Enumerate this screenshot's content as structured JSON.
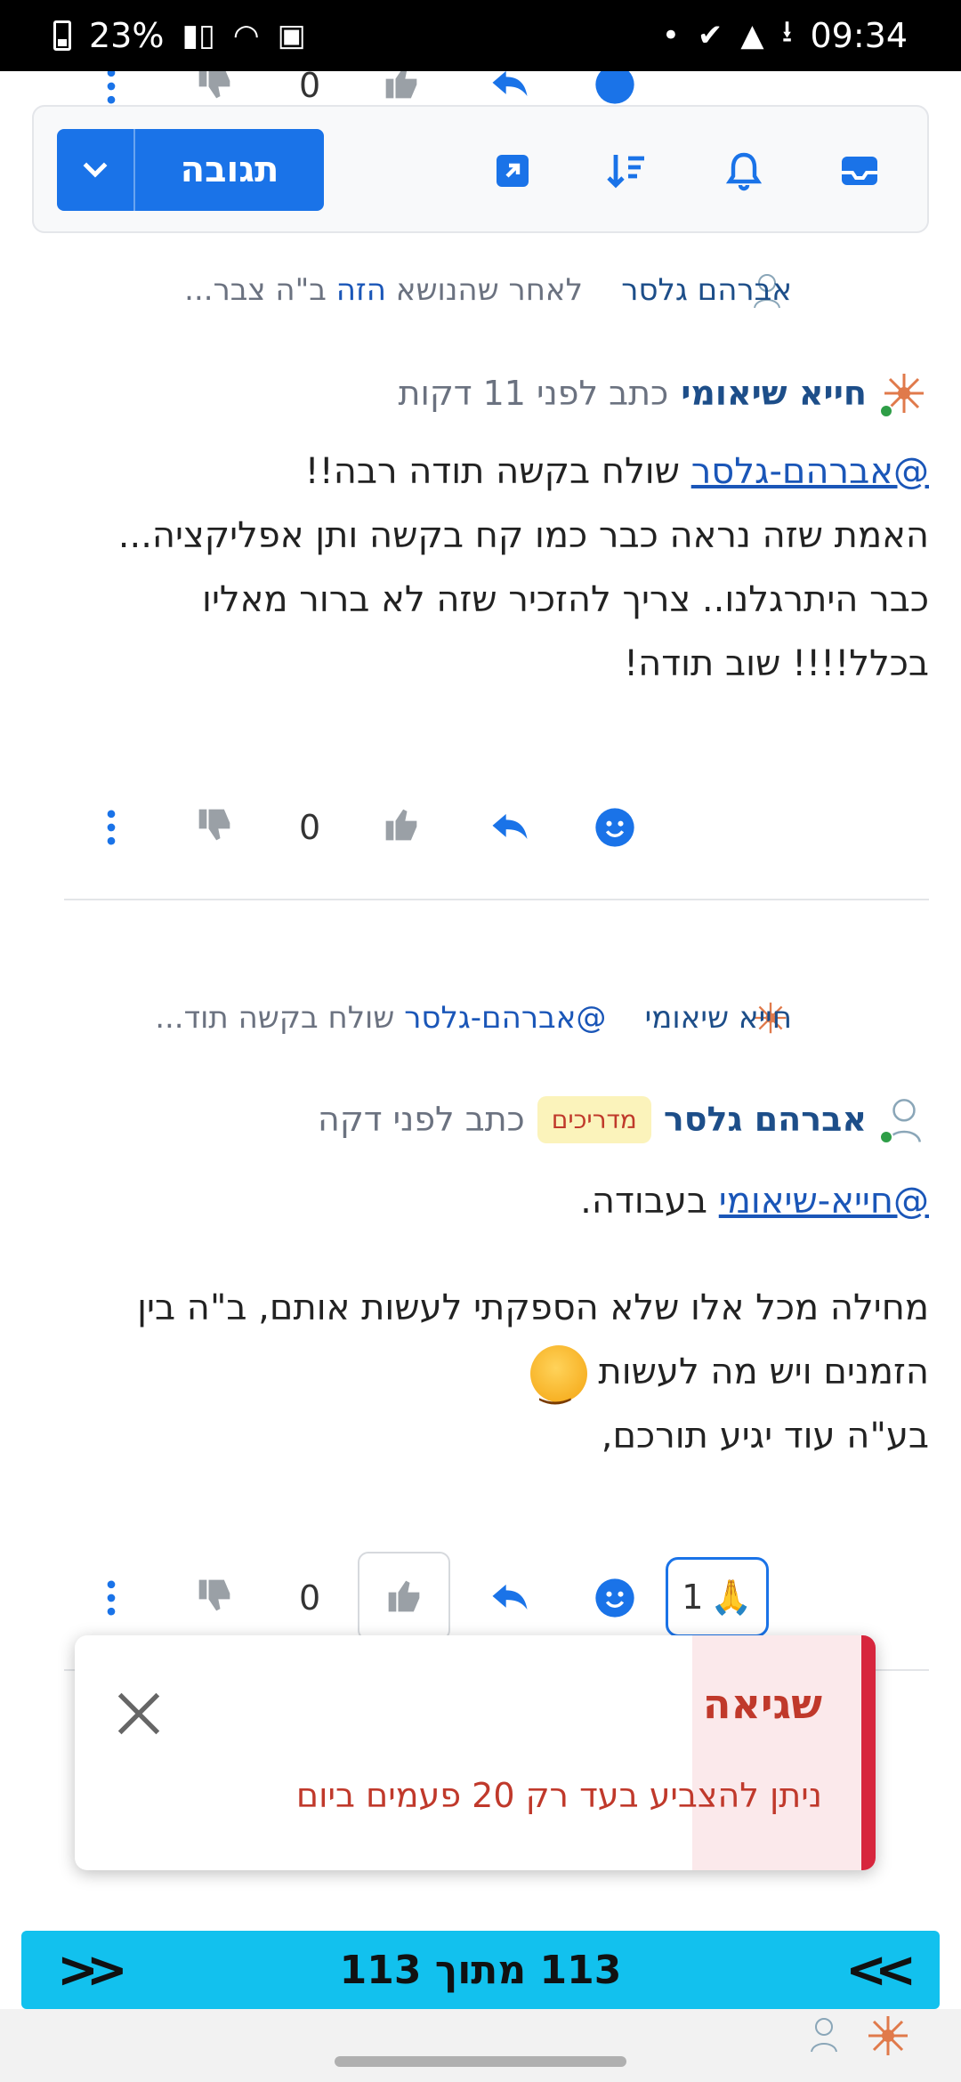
{
  "status_bar": {
    "battery": "23%",
    "time": "09:34"
  },
  "toolbar": {
    "reply_label": "תגובה",
    "icons": [
      "chevron-down-icon",
      "share-icon",
      "sort-icon",
      "bell-icon",
      "inbox-icon"
    ]
  },
  "peek_row": {
    "vote_count": "0"
  },
  "post1": {
    "parent": {
      "author": "אברהם גלסר",
      "excerpt_pre": "לאחר שהנושא ",
      "excerpt_link": "הזה",
      "excerpt_post": " ב\"ה צבר..."
    },
    "author": "חייא שיאומי",
    "meta": "כתב לפני 11 דקות",
    "mention": "@אברהם-גלסר",
    "line1_rest": " שולח בקשה תודה רבה!!",
    "line2": "האמת שזה נראה כבר כמו קח בקשה ותן אפליקציה...",
    "line3": "כבר היתרגלנו.. צריך להזכיר שזה לא ברור מאליו",
    "line4": "בכלל!!!! שוב תודה!",
    "vote_count": "0"
  },
  "post2": {
    "parent": {
      "author": "חייא שיאומי",
      "mention": "@אברהם-גלסר",
      "excerpt": " שולח בקשה תוד..."
    },
    "author": "אברהם גלסר",
    "badge": "מדריכים",
    "meta": "כתב לפני דקה",
    "mention": "@חייא-שיאומי",
    "line1_rest": " בעבודה.",
    "line2": "מחילה מכל אלו שלא הספקתי לעשות אותם, ב\"ה בין",
    "line3": "הזמנים ויש מה לעשות",
    "line4": "בע\"ה עוד יגיע תורכם,",
    "vote_count": "0",
    "reaction_count": "1",
    "reaction_emoji": "🙏"
  },
  "toast": {
    "title": "שגיאה",
    "message": "ניתן להצביע בעד רק 20 פעמים ביום"
  },
  "pager": {
    "label": "113 מתוך 113"
  },
  "colors": {
    "accent": "#1a73e8",
    "pager": "#12c1ee",
    "error": "#d7263d"
  }
}
